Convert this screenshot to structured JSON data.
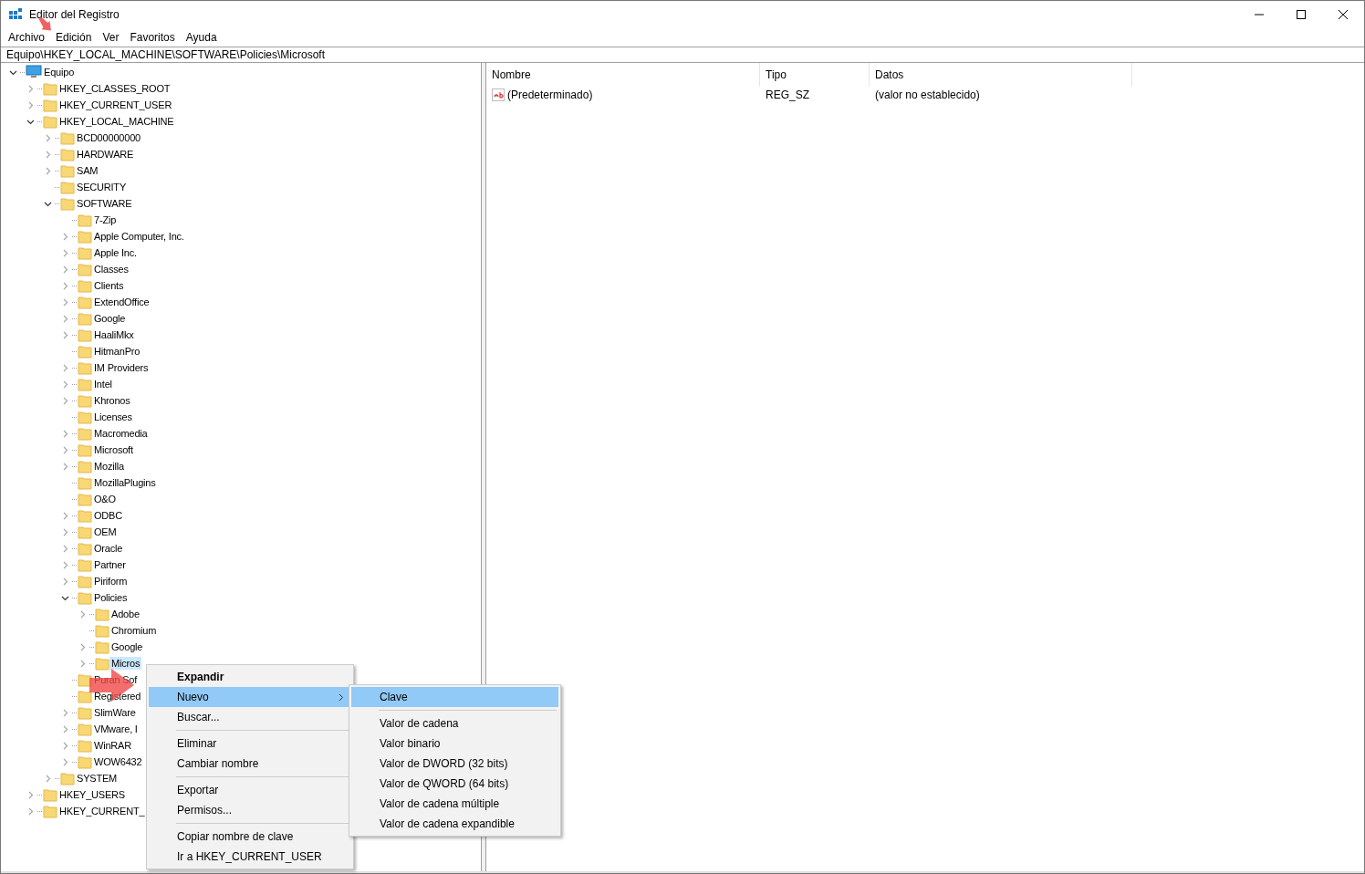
{
  "window": {
    "title": "Editor del Registro"
  },
  "menu_bar": [
    "Archivo",
    "Edición",
    "Ver",
    "Favoritos",
    "Ayuda"
  ],
  "address": "Equipo\\HKEY_LOCAL_MACHINE\\SOFTWARE\\Policies\\Microsoft",
  "tree": {
    "label": "Equipo",
    "kind": "computer",
    "expandable": true,
    "expanded": true,
    "selected": false,
    "children": [
      {
        "label": "HKEY_CLASSES_ROOT",
        "expandable": true,
        "expanded": false,
        "selected": false
      },
      {
        "label": "HKEY_CURRENT_USER",
        "expandable": true,
        "expanded": false,
        "selected": false
      },
      {
        "label": "HKEY_LOCAL_MACHINE",
        "expandable": true,
        "expanded": true,
        "selected": false,
        "children": [
          {
            "label": "BCD00000000",
            "expandable": true,
            "expanded": false,
            "selected": false
          },
          {
            "label": "HARDWARE",
            "expandable": true,
            "expanded": false,
            "selected": false
          },
          {
            "label": "SAM",
            "expandable": true,
            "expanded": false,
            "selected": false
          },
          {
            "label": "SECURITY",
            "expandable": false,
            "expanded": false,
            "selected": false
          },
          {
            "label": "SOFTWARE",
            "expandable": true,
            "expanded": true,
            "selected": false,
            "children": [
              {
                "label": "7-Zip",
                "expandable": false,
                "expanded": false,
                "selected": false
              },
              {
                "label": "Apple Computer, Inc.",
                "expandable": true,
                "expanded": false,
                "selected": false
              },
              {
                "label": "Apple Inc.",
                "expandable": true,
                "expanded": false,
                "selected": false
              },
              {
                "label": "Classes",
                "expandable": true,
                "expanded": false,
                "selected": false
              },
              {
                "label": "Clients",
                "expandable": true,
                "expanded": false,
                "selected": false
              },
              {
                "label": "ExtendOffice",
                "expandable": true,
                "expanded": false,
                "selected": false
              },
              {
                "label": "Google",
                "expandable": true,
                "expanded": false,
                "selected": false
              },
              {
                "label": "HaaliMkx",
                "expandable": true,
                "expanded": false,
                "selected": false
              },
              {
                "label": "HitmanPro",
                "expandable": false,
                "expanded": false,
                "selected": false
              },
              {
                "label": "IM Providers",
                "expandable": true,
                "expanded": false,
                "selected": false
              },
              {
                "label": "Intel",
                "expandable": true,
                "expanded": false,
                "selected": false
              },
              {
                "label": "Khronos",
                "expandable": true,
                "expanded": false,
                "selected": false
              },
              {
                "label": "Licenses",
                "expandable": false,
                "expanded": false,
                "selected": false
              },
              {
                "label": "Macromedia",
                "expandable": true,
                "expanded": false,
                "selected": false
              },
              {
                "label": "Microsoft",
                "expandable": true,
                "expanded": false,
                "selected": false
              },
              {
                "label": "Mozilla",
                "expandable": true,
                "expanded": false,
                "selected": false
              },
              {
                "label": "MozillaPlugins",
                "expandable": false,
                "expanded": false,
                "selected": false
              },
              {
                "label": "O&O",
                "expandable": false,
                "expanded": false,
                "selected": false
              },
              {
                "label": "ODBC",
                "expandable": true,
                "expanded": false,
                "selected": false
              },
              {
                "label": "OEM",
                "expandable": true,
                "expanded": false,
                "selected": false
              },
              {
                "label": "Oracle",
                "expandable": true,
                "expanded": false,
                "selected": false
              },
              {
                "label": "Partner",
                "expandable": true,
                "expanded": false,
                "selected": false
              },
              {
                "label": "Piriform",
                "expandable": true,
                "expanded": false,
                "selected": false
              },
              {
                "label": "Policies",
                "expandable": true,
                "expanded": true,
                "selected": false,
                "children": [
                  {
                    "label": "Adobe",
                    "expandable": true,
                    "expanded": false,
                    "selected": false
                  },
                  {
                    "label": "Chromium",
                    "expandable": false,
                    "expanded": false,
                    "selected": false
                  },
                  {
                    "label": "Google",
                    "expandable": true,
                    "expanded": false,
                    "selected": false
                  },
                  {
                    "label": "Micros",
                    "expandable": true,
                    "expanded": false,
                    "selected": true
                  }
                ]
              },
              {
                "label": "Puran Sof",
                "expandable": false,
                "expanded": false,
                "selected": false
              },
              {
                "label": "Registered",
                "expandable": false,
                "expanded": false,
                "selected": false
              },
              {
                "label": "SlimWare",
                "expandable": true,
                "expanded": false,
                "selected": false
              },
              {
                "label": "VMware, I",
                "expandable": true,
                "expanded": false,
                "selected": false
              },
              {
                "label": "WinRAR",
                "expandable": true,
                "expanded": false,
                "selected": false
              },
              {
                "label": "WOW6432",
                "expandable": true,
                "expanded": false,
                "selected": false
              }
            ]
          },
          {
            "label": "SYSTEM",
            "expandable": true,
            "expanded": false,
            "selected": false
          }
        ]
      },
      {
        "label": "HKEY_USERS",
        "expandable": true,
        "expanded": false,
        "selected": false
      },
      {
        "label": "HKEY_CURRENT_",
        "expandable": true,
        "expanded": false,
        "selected": false
      }
    ]
  },
  "list": {
    "columns": [
      "Nombre",
      "Tipo",
      "Datos"
    ],
    "rows": [
      {
        "name": "(Predeterminado)",
        "type": "REG_SZ",
        "data": "(valor no establecido)"
      }
    ]
  },
  "context_menu": {
    "groups": [
      [
        {
          "label": "Expandir",
          "bold": true,
          "selected": false,
          "submenu": false
        },
        {
          "label": "Nuevo",
          "bold": false,
          "selected": true,
          "submenu": true
        },
        {
          "label": "Buscar...",
          "bold": false,
          "selected": false,
          "submenu": false
        }
      ],
      [
        {
          "label": "Eliminar",
          "bold": false,
          "selected": false,
          "submenu": false
        },
        {
          "label": "Cambiar nombre",
          "bold": false,
          "selected": false,
          "submenu": false
        }
      ],
      [
        {
          "label": "Exportar",
          "bold": false,
          "selected": false,
          "submenu": false
        },
        {
          "label": "Permisos...",
          "bold": false,
          "selected": false,
          "submenu": false
        }
      ],
      [
        {
          "label": "Copiar nombre de clave",
          "bold": false,
          "selected": false,
          "submenu": false
        },
        {
          "label": "Ir a HKEY_CURRENT_USER",
          "bold": false,
          "selected": false,
          "submenu": false
        }
      ]
    ]
  },
  "submenu": {
    "groups": [
      [
        {
          "label": "Clave",
          "selected": true
        }
      ],
      [
        {
          "label": "Valor de cadena",
          "selected": false
        },
        {
          "label": "Valor binario",
          "selected": false
        },
        {
          "label": "Valor de DWORD (32 bits)",
          "selected": false
        },
        {
          "label": "Valor de QWORD (64 bits)",
          "selected": false
        },
        {
          "label": "Valor de cadena múltiple",
          "selected": false
        },
        {
          "label": "Valor de cadena expandible",
          "selected": false
        }
      ]
    ]
  }
}
